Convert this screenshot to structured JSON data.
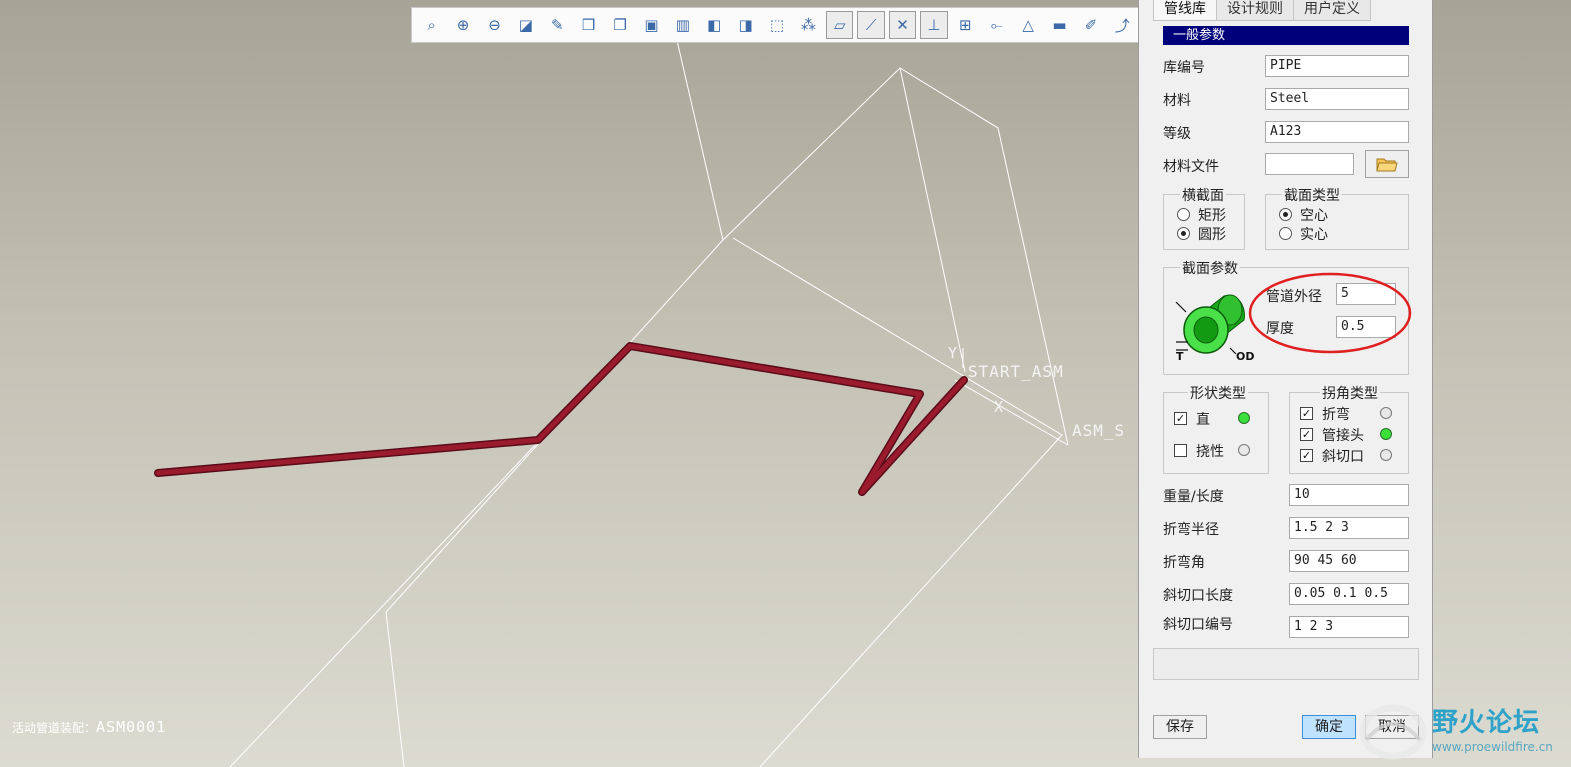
{
  "viewport": {
    "labels": {
      "start_asm": "START_ASM",
      "asm_s": "ASM_S",
      "axis_y": "Y",
      "axis_x": "X"
    },
    "status": {
      "label": "活动管道装配：",
      "value": "ASM0001"
    }
  },
  "toolbar": {
    "items": [
      {
        "name": "zoom-fit-icon",
        "glyph": "⌕",
        "active": false
      },
      {
        "name": "zoom-in-icon",
        "glyph": "⊕",
        "active": false
      },
      {
        "name": "zoom-out-icon",
        "glyph": "⊖",
        "active": false
      },
      {
        "name": "refit-icon",
        "glyph": "◪",
        "active": false
      },
      {
        "name": "repaint-icon",
        "glyph": "✎",
        "active": false
      },
      {
        "name": "view-cube-icon",
        "glyph": "❒",
        "active": false
      },
      {
        "name": "saved-views-icon",
        "glyph": "❐",
        "active": false
      },
      {
        "name": "camera-icon",
        "glyph": "▣",
        "active": false
      },
      {
        "name": "layers-icon",
        "glyph": "▥",
        "active": false
      },
      {
        "name": "datum-plane-icon",
        "glyph": "◧",
        "active": false
      },
      {
        "name": "datum-add-icon",
        "glyph": "◨",
        "active": false
      },
      {
        "name": "wireframe-box-icon",
        "glyph": "⬚",
        "active": false
      },
      {
        "name": "csys-points-icon",
        "glyph": "⁂",
        "active": false
      },
      {
        "name": "plane-display-icon",
        "glyph": "▱",
        "active": true
      },
      {
        "name": "axis-display-icon",
        "glyph": "⟋",
        "active": true
      },
      {
        "name": "point-display-icon",
        "glyph": "✕",
        "active": true
      },
      {
        "name": "csys-display-icon",
        "glyph": "⊥",
        "active": true
      },
      {
        "name": "route-tree-icon",
        "glyph": "⊞",
        "active": false
      },
      {
        "name": "branch-icon",
        "glyph": "⟜",
        "active": false
      },
      {
        "name": "warning-icon",
        "glyph": "△",
        "active": false
      },
      {
        "name": "pipe-segment-icon",
        "glyph": "▬",
        "active": false
      },
      {
        "name": "pen-icon",
        "glyph": "✐",
        "active": false
      },
      {
        "name": "route-edit-icon",
        "glyph": "⤴",
        "active": false
      }
    ]
  },
  "dialog": {
    "tabs": [
      "管线库",
      "设计规则",
      "用户定义"
    ],
    "general_header": "一般参数",
    "fields": {
      "lib_id": {
        "label": "库编号",
        "value": "PIPE"
      },
      "material": {
        "label": "材料",
        "value": "Steel"
      },
      "grade": {
        "label": "等级",
        "value": "A123"
      },
      "material_file": {
        "label": "材料文件",
        "value": ""
      }
    },
    "cross_section": {
      "title": "横截面",
      "options": [
        "矩形",
        "圆形"
      ],
      "selected": 1
    },
    "section_type": {
      "title": "截面类型",
      "options": [
        "空心",
        "实心"
      ],
      "selected": 0
    },
    "section_params": {
      "title": "截面参数",
      "od_label": "管道外径",
      "od_value": "5",
      "thickness_label": "厚度",
      "thickness_value": "0.5",
      "diagram_od": "OD",
      "diagram_t": "T"
    },
    "shape_type": {
      "title": "形状类型",
      "items": [
        {
          "label": "直",
          "checked": true,
          "indicator": "green"
        },
        {
          "label": "挠性",
          "checked": false,
          "indicator": "grey"
        }
      ]
    },
    "corner_type": {
      "title": "拐角类型",
      "items": [
        {
          "label": "折弯",
          "checked": true,
          "indicator": "grey"
        },
        {
          "label": "管接头",
          "checked": true,
          "indicator": "green"
        },
        {
          "label": "斜切口",
          "checked": true,
          "indicator": "grey"
        }
      ]
    },
    "params": [
      {
        "label": "重量/长度",
        "value": "10"
      },
      {
        "label": "折弯半径",
        "value": "1.5 2 3"
      },
      {
        "label": "折弯角",
        "value": "90 45 60"
      },
      {
        "label": "斜切口长度",
        "value": "0.05 0.1 0.5"
      },
      {
        "label": "斜切口编号",
        "value": "1 2 3"
      }
    ],
    "buttons": {
      "save": "保存",
      "ok": "确定",
      "cancel": "取消"
    }
  },
  "watermark": {
    "title": "野火论坛",
    "url": "www.proewildfire.cn"
  },
  "colors": {
    "pipe": "#8e1426",
    "header": "#00007a",
    "highlight_circle": "#e02020",
    "indicator_green": "#3adf3a"
  }
}
